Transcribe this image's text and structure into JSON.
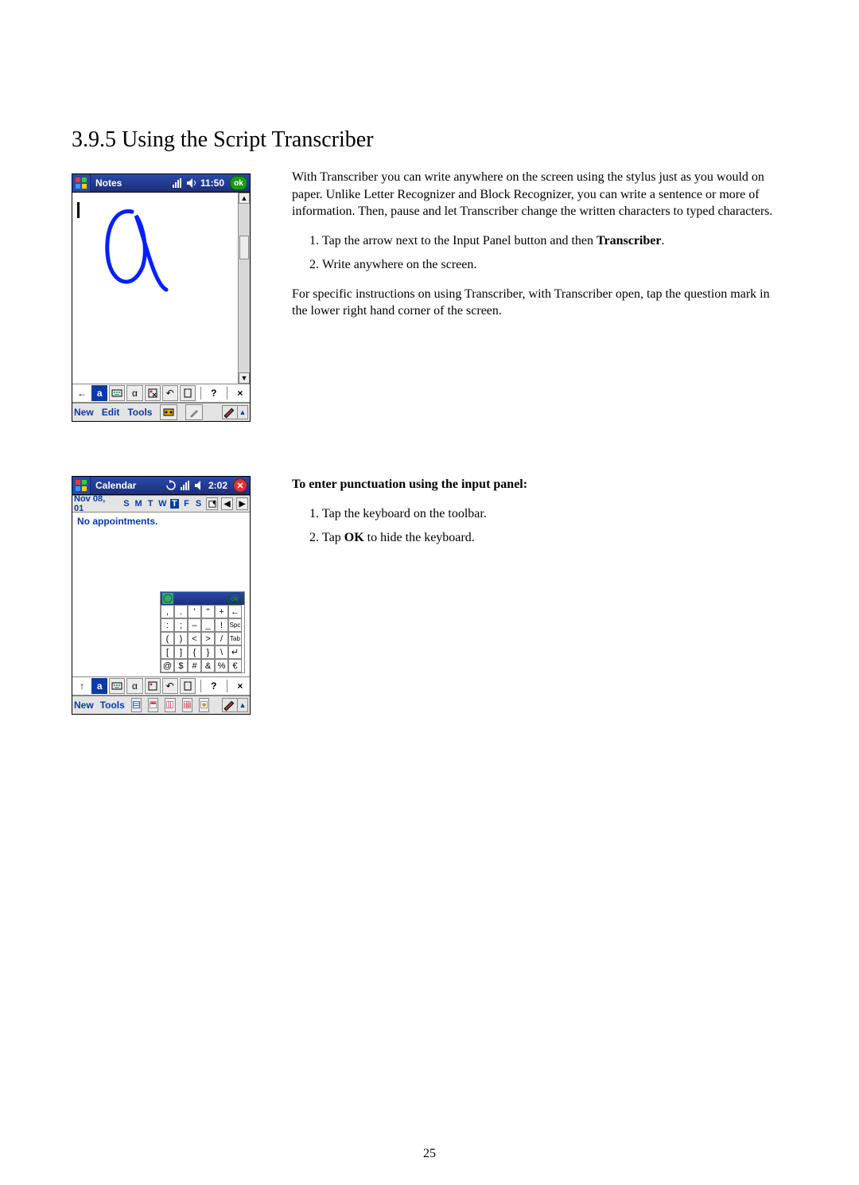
{
  "section_title": "3.9.5 Using the Script Transcriber",
  "notes_mock": {
    "app_label": "Notes",
    "time": "11:50",
    "ok_label": "ok",
    "toolbar": {
      "back": "←",
      "a_btn": "a",
      "keyboard_icon": "kbd",
      "alpha": "α",
      "opts": "opt",
      "undo": "↶",
      "paste": "paste",
      "help": "?",
      "close": "×"
    },
    "menu": {
      "new": "New",
      "edit": "Edit",
      "tools": "Tools"
    }
  },
  "transcriber_intro": "With Transcriber you can write anywhere on the screen using the stylus just as you would on paper. Unlike Letter Recognizer and Block Recognizer, you can write a sentence or more of information. Then, pause and let Transcriber change the written characters to typed characters.",
  "transcriber_steps": {
    "s1_pre": "Tap the arrow next to the Input Panel button and then ",
    "s1_bold": "Transcriber",
    "s1_post": ".",
    "s2": "Write anywhere on the screen."
  },
  "transcriber_footer": "For specific instructions on using Transcriber, with Transcriber open, tap the question mark in the lower right hand corner of the screen.",
  "cal_mock": {
    "app_label": "Calendar",
    "time": "2:02",
    "date": "Nov 08, 01",
    "days": [
      "S",
      "M",
      "T",
      "W",
      "T",
      "F",
      "S"
    ],
    "selected_day_index": 4,
    "no_appts": "No appointments.",
    "ok_mini": "ok",
    "panel_rows": [
      [
        ",",
        ".",
        "'",
        "''",
        "+",
        "←"
      ],
      [
        ":",
        ";",
        "–",
        "_",
        "!",
        "Spc"
      ],
      [
        "(",
        ")",
        "<",
        ">",
        "/",
        "Tab"
      ],
      [
        "[",
        "]",
        "{",
        "}",
        "\\",
        "↵"
      ],
      [
        "@",
        "$",
        "#",
        "&",
        "%",
        "€"
      ]
    ],
    "toolbar": {
      "caps": "↑",
      "help": "?",
      "close": "×"
    },
    "menu": {
      "new": "New",
      "tools": "Tools"
    }
  },
  "punct_heading": "To enter punctuation using the input panel:",
  "punct_steps": {
    "s1": "Tap the keyboard on the toolbar.",
    "s2_pre": "Tap ",
    "s2_bold": "OK",
    "s2_post": " to hide the keyboard."
  },
  "page_number": "25"
}
